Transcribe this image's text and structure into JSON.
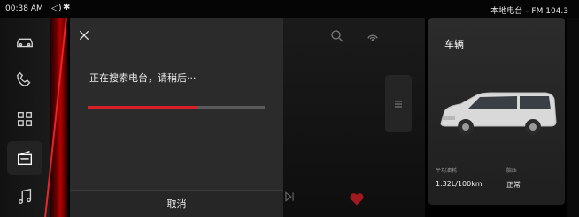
{
  "status_bar": {
    "time": "00:38 AM",
    "volume_icon": "volume-icon",
    "bluetooth_icon": "bluetooth-icon",
    "station": "本地电台 – FM 104.3"
  },
  "nav": {
    "items": [
      {
        "icon": "car-icon",
        "active": false
      },
      {
        "icon": "phone-icon",
        "active": false
      },
      {
        "icon": "apps-grid-icon",
        "active": false
      },
      {
        "icon": "radio-icon",
        "active": true
      },
      {
        "icon": "music-icon",
        "active": false
      }
    ]
  },
  "dialog": {
    "close_icon": "close-icon",
    "message": "正在搜索电台，请稍后···",
    "progress": 0.62,
    "cancel_label": "取消"
  },
  "radio": {
    "search_icon": "search-icon",
    "signal_icon": "signal-icon",
    "list_icon": "list-icon",
    "next_icon": "skip-next-icon",
    "favorite_icon": "heart-icon"
  },
  "vehicle": {
    "title": "车辆",
    "stats": [
      {
        "label": "平均油耗",
        "value": "1.32L/100km"
      },
      {
        "label": "胎压",
        "value": "正常"
      }
    ]
  },
  "colors": {
    "accent": "#d81e26",
    "dialog_bg": "#2b2b2b",
    "card_bg": "#2c2c2c"
  }
}
